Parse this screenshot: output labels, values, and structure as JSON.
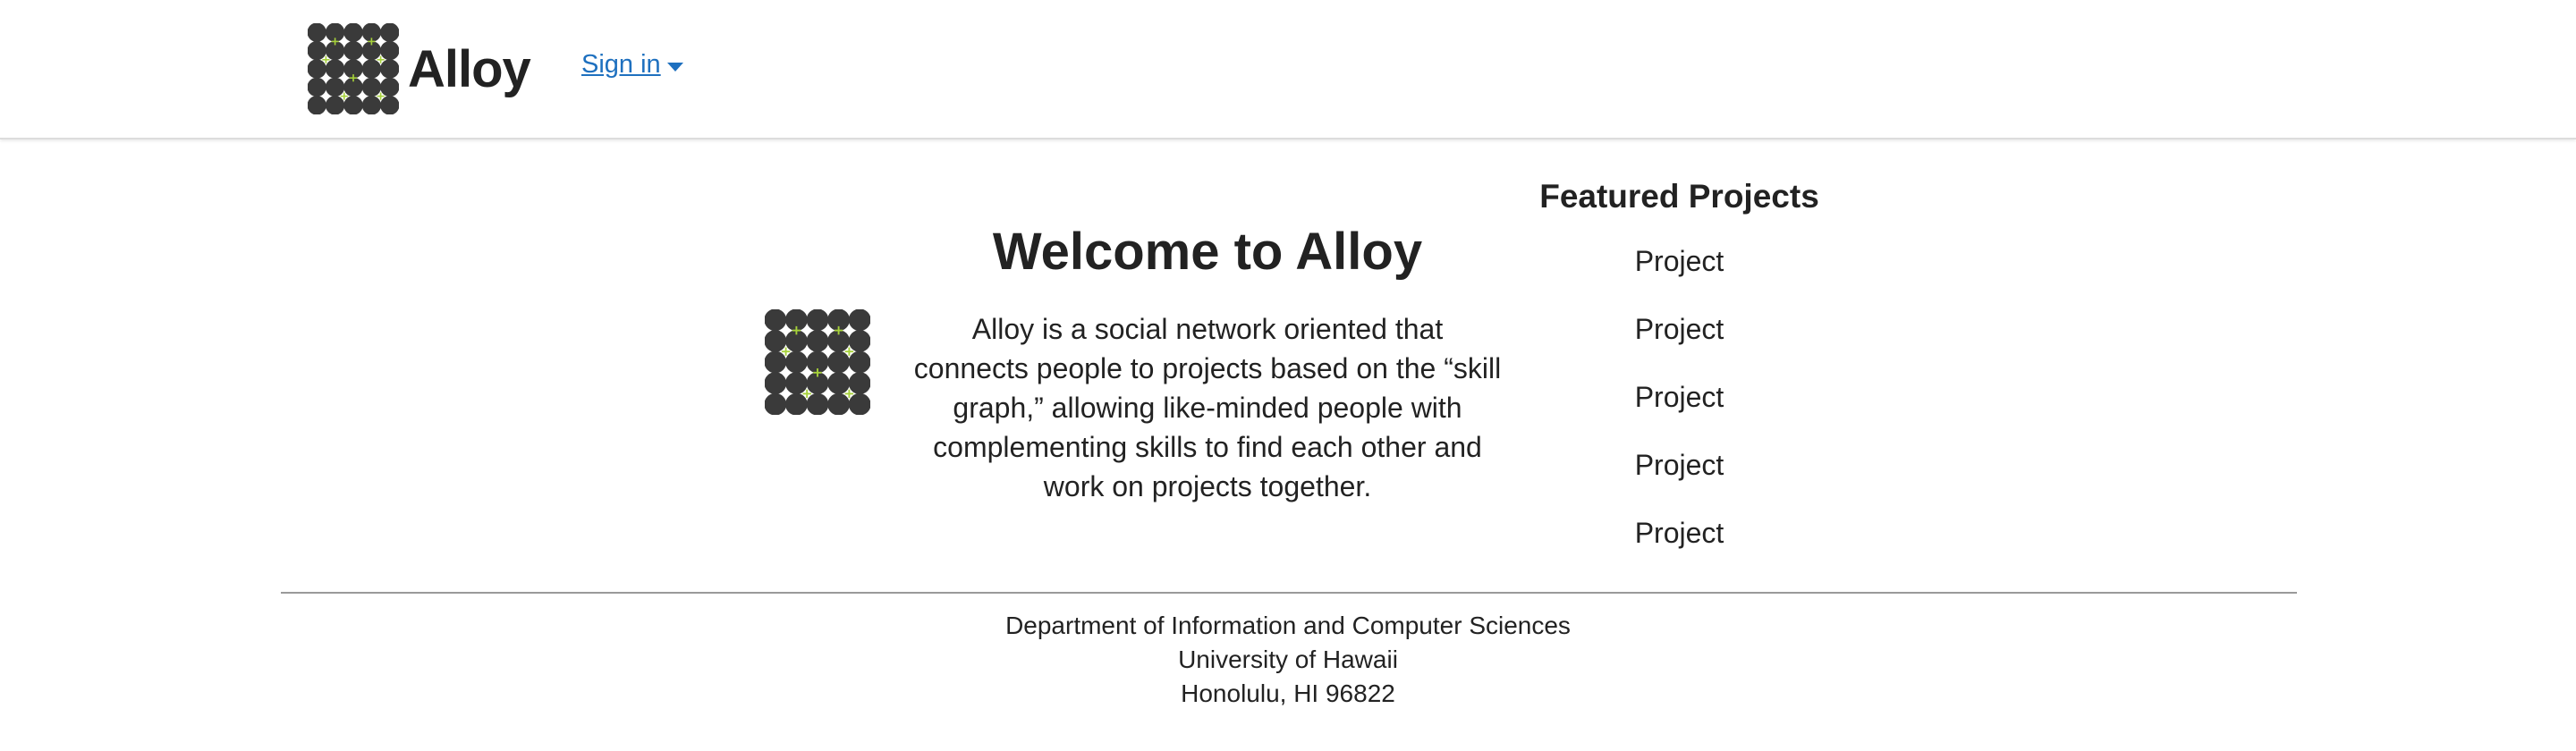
{
  "header": {
    "brand_name": "Alloy",
    "logo_icon": "alloy-dot-grid-logo",
    "signin_label": "Sign in",
    "signin_icon": "caret-down-icon",
    "link_color": "#1e70bf"
  },
  "main": {
    "title": "Welcome to Alloy",
    "description": "Alloy is a social network oriented that connects people to projects based on the “skill graph,” allowing like-minded people with complementing skills to find each other and work on projects together.",
    "logo_icon": "alloy-dot-grid-logo"
  },
  "featured": {
    "title": "Featured Projects",
    "projects": [
      "Project",
      "Project",
      "Project",
      "Project",
      "Project"
    ]
  },
  "footer": {
    "line1": "Department of Information and Computer Sciences",
    "line2": "University of Hawaii",
    "line3": "Honolulu, HI 96822"
  },
  "colors": {
    "logo_dot": "#3a3a3a",
    "logo_accent": "#a6d13a"
  }
}
